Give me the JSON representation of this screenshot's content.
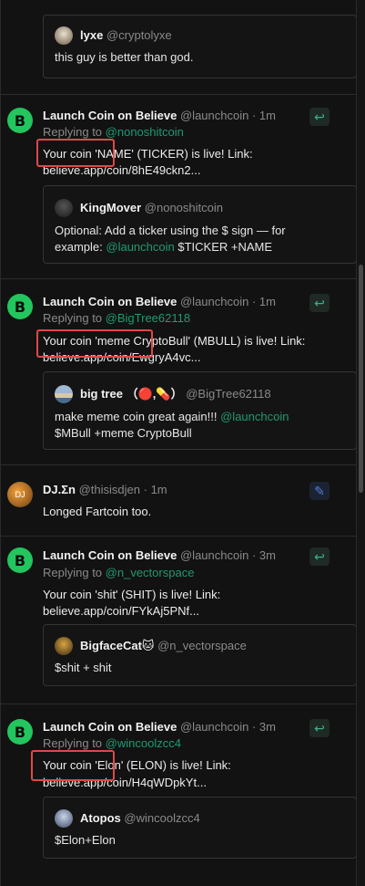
{
  "posts": [
    {
      "quote": {
        "name": "lyxe",
        "handle": "@cryptolyxe",
        "text": "this guy is better than god."
      }
    },
    {
      "name": "Launch Coin on Believe",
      "handle": "@launchcoin",
      "time": "· 1m",
      "replying_prefix": "Replying to",
      "replying_to": "@nonoshitcoin",
      "text": "Your coin 'NAME' (TICKER) is live! Link:",
      "link": "believe.app/coin/8hE49ckn2...",
      "quote": {
        "name": "KingMover",
        "handle": "@nonoshitcoin",
        "line1": "Optional: Add a ticker using the $ sign — for",
        "line2_prefix": "example:",
        "line2_link": "@launchcoin",
        "line2_suffix": "$TICKER +NAME"
      }
    },
    {
      "name": "Launch Coin on Believe",
      "handle": "@launchcoin",
      "time": "· 1m",
      "replying_prefix": "Replying to",
      "replying_to": "@BigTree62118",
      "text": "Your coin 'meme CryptoBull' (MBULL) is live! Link:",
      "link": "believe.app/coin/EwgryA4vc...",
      "quote": {
        "name": "big tree",
        "emoji": "（🔴,💊）",
        "handle": "@BigTree62118",
        "line1_prefix": "make meme coin great again!!!",
        "line1_link": "@launchcoin",
        "line2": "$MBull +meme CryptoBull"
      }
    },
    {
      "name": "DJ.Σn",
      "handle": "@thisisdjen",
      "time": "· 1m",
      "text": "Longed Fartcoin too."
    },
    {
      "name": "Launch Coin on Believe",
      "handle": "@launchcoin",
      "time": "· 3m",
      "replying_prefix": "Replying to",
      "replying_to": "@n_vectorspace",
      "text": "Your coin 'shit' (SHIT) is live! Link:",
      "link": "believe.app/coin/FYkAj5PNf...",
      "quote": {
        "name": "BigfaceCat🐱",
        "handle": "@n_vectorspace",
        "line1": "$shit + shit"
      }
    },
    {
      "name": "Launch Coin on Believe",
      "handle": "@launchcoin",
      "time": "· 3m",
      "replying_prefix": "Replying to",
      "replying_to": "@wincoolzcc4",
      "text": "Your coin 'Elon' (ELON) is live! Link:",
      "link": "believe.app/coin/H4qWDpkYt...",
      "quote": {
        "name": "Atopos",
        "handle": "@wincoolzcc4",
        "line1": "$Elon+Elon"
      }
    }
  ],
  "icons": {
    "believe_avatar": "B",
    "reply_action": "↩",
    "quote_action": "✎"
  },
  "colors": {
    "accent": "#1d9b74",
    "highlight": "#e04848",
    "believe_green": "#22c55e"
  }
}
